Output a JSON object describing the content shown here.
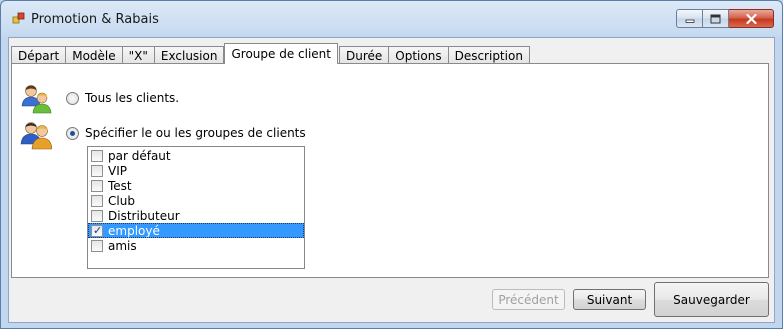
{
  "window": {
    "title": "Promotion & Rabais",
    "icon": "app-icon",
    "caption_buttons": [
      "minimize-icon",
      "maximize-icon",
      "close-icon"
    ]
  },
  "tabs": [
    {
      "label": "Départ",
      "active": false
    },
    {
      "label": "Modèle",
      "active": false
    },
    {
      "label": "\"X\"",
      "active": false
    },
    {
      "label": "Exclusion",
      "active": false
    },
    {
      "label": "Groupe de client",
      "active": true
    },
    {
      "label": "Durée",
      "active": false
    },
    {
      "label": "Options",
      "active": false
    },
    {
      "label": "Description",
      "active": false
    }
  ],
  "options": {
    "all_clients": {
      "label": "Tous les clients.",
      "selected": false
    },
    "specific_groups": {
      "label": "Spécifier le ou les groupes de clients",
      "selected": true
    }
  },
  "groups": [
    {
      "label": "par défaut",
      "checked": false,
      "selected": false
    },
    {
      "label": "VIP",
      "checked": false,
      "selected": false
    },
    {
      "label": "Test",
      "checked": false,
      "selected": false
    },
    {
      "label": "Club",
      "checked": false,
      "selected": false
    },
    {
      "label": "Distributeur",
      "checked": false,
      "selected": false
    },
    {
      "label": "employé",
      "checked": true,
      "selected": true
    },
    {
      "label": "amis",
      "checked": false,
      "selected": false
    }
  ],
  "buttons": {
    "previous": "Précédent",
    "next": "Suivant",
    "save": "Sauvegarder"
  },
  "colors": {
    "selection": "#3399ff",
    "title_bar": "#c9dcf1",
    "close_button": "#c43a1f"
  }
}
